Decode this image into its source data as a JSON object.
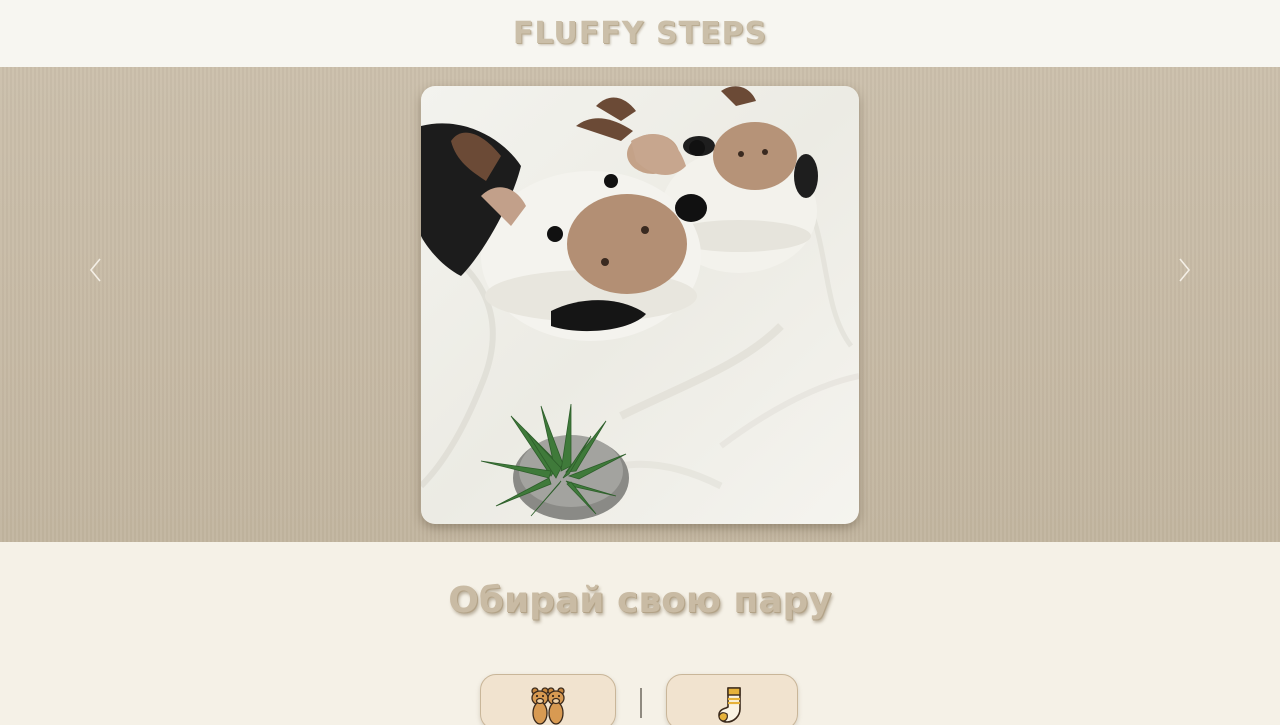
{
  "header": {
    "brand": "FLUFFY STEPS"
  },
  "hero": {
    "prev_icon": "chevron-left-icon",
    "next_icon": "chevron-right-icon",
    "slide_description_icon": "product-photo"
  },
  "catalog": {
    "title": "Обирай свою пару",
    "categories": [
      {
        "icon": "bear-slippers-icon"
      },
      {
        "icon": "sock-icon"
      }
    ]
  },
  "colors": {
    "page_bg": "#f5f1e7",
    "header_bg": "#f7f6f1",
    "hero_bg": "#c6b9a4",
    "brand": "#cbbfa9",
    "button_bg": "#f1e3cf"
  }
}
